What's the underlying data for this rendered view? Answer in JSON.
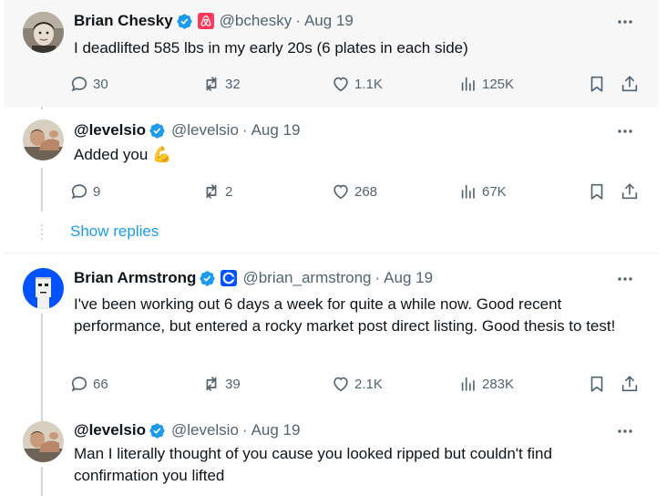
{
  "tweets": [
    {
      "name": "Brian Chesky",
      "handle": "@bchesky",
      "separator": "·",
      "date": "Aug 19",
      "affiliate": "airbnb",
      "text": "I deadlifted 585 lbs in my early 20s (6 plates in each side)",
      "counts": {
        "reply": "30",
        "retweet": "32",
        "like": "1.1K",
        "views": "125K"
      }
    },
    {
      "name": "@levelsio",
      "handle": "@levelsio",
      "separator": "·",
      "date": "Aug 19",
      "text": "Added you 💪",
      "counts": {
        "reply": "9",
        "retweet": "2",
        "like": "268",
        "views": "67K"
      }
    },
    {
      "name": "Brian Armstrong",
      "handle": "@brian_armstrong",
      "separator": "·",
      "date": "Aug 19",
      "affiliate": "coinbase",
      "text": "I've been working out 6 days a week for quite a while now. Good recent performance, but entered a rocky market post direct listing. Good thesis to test!",
      "counts": {
        "reply": "66",
        "retweet": "39",
        "like": "2.1K",
        "views": "283K"
      }
    },
    {
      "name": "@levelsio",
      "handle": "@levelsio",
      "separator": "·",
      "date": "Aug 19",
      "text": "Man I literally thought of you cause you looked ripped but couldn't find confirmation you lifted"
    }
  ],
  "show_replies": "Show replies",
  "colors": {
    "accent": "#1d9bf0",
    "verified": "#1d9bf0",
    "airbnb": "#ff385c",
    "coinbase": "#0052ff",
    "muted": "#536471",
    "thread_line": "#cfd9de"
  },
  "icons": [
    "more-icon",
    "verified-badge-icon",
    "reply-icon",
    "retweet-icon",
    "like-icon",
    "views-icon",
    "bookmark-icon",
    "share-icon"
  ]
}
